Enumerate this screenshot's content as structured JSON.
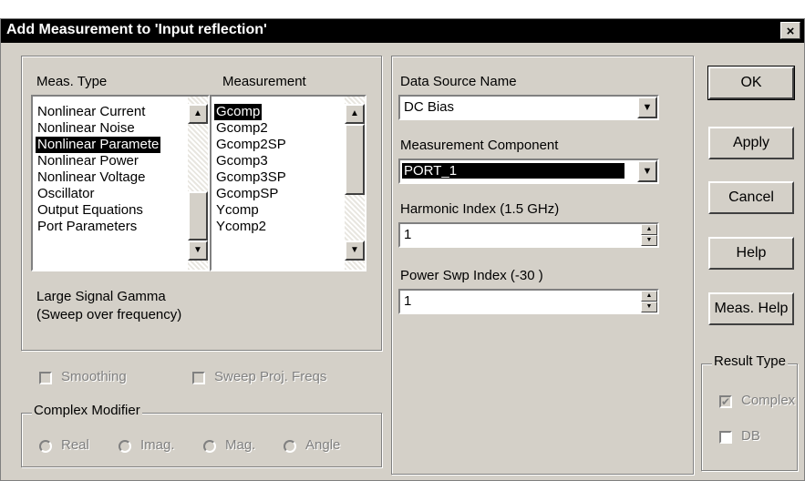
{
  "dialog": {
    "title": "Add Measurement to 'Input reflection'",
    "close_glyph": "×"
  },
  "meas_panel": {
    "type_header": "Meas. Type",
    "measurement_header": "Measurement",
    "types": [
      "Nonlinear Current",
      "Nonlinear Noise",
      "Nonlinear Paramete",
      "Nonlinear Power",
      "Nonlinear Voltage",
      "Oscillator",
      "Output Equations",
      "Port Parameters"
    ],
    "types_selected": "Nonlinear Paramete",
    "measurements": [
      "Gcomp",
      "Gcomp2",
      "Gcomp2SP",
      "Gcomp3",
      "Gcomp3SP",
      "GcompSP",
      "Ycomp",
      "Ycomp2"
    ],
    "measurements_selected": "Gcomp",
    "description_line1": "Large Signal Gamma",
    "description_line2": "(Sweep over frequency)"
  },
  "options": {
    "smoothing_label": "Smoothing",
    "sweep_proj_label": "Sweep Proj. Freqs"
  },
  "complex_modifier": {
    "legend": "Complex Modifier",
    "real": "Real",
    "imag": "Imag.",
    "mag": "Mag.",
    "angle": "Angle"
  },
  "source_panel": {
    "data_source_label": "Data Source Name",
    "data_source_value": "DC Bias",
    "component_label": "Measurement Component",
    "component_value": "PORT_1",
    "harmonic_label": "Harmonic Index (1.5 GHz)",
    "harmonic_value": "1",
    "power_label": "Power Swp Index (-30 )",
    "power_value": "1"
  },
  "buttons": {
    "ok": "OK",
    "apply": "Apply",
    "cancel": "Cancel",
    "help": "Help",
    "meas_help": "Meas. Help"
  },
  "result_type": {
    "legend": "Result Type",
    "complex_label": "Complex",
    "complex_checked": true,
    "db_label": "DB",
    "db_checked": false
  },
  "icons": {
    "up": "▲",
    "down": "▼",
    "check": "✔"
  }
}
